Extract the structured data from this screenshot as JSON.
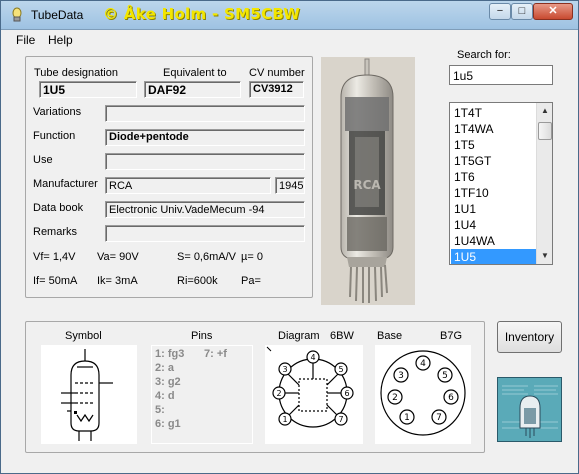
{
  "window": {
    "title": "TubeData",
    "author": "© Åke Holm - SM5CBW",
    "minimize_glyph": "−",
    "restore_glyph": "□",
    "close_glyph": "✕"
  },
  "menu": {
    "file": "File",
    "help": "Help"
  },
  "header": {
    "designation_label": "Tube designation",
    "designation": "1U5",
    "equivalent_label": "Equivalent to",
    "equivalent": "DAF92",
    "cv_label": "CV number",
    "cv": "CV3912"
  },
  "details": {
    "variations_label": "Variations",
    "variations": "",
    "function_label": "Function",
    "function": "Diode+pentode",
    "use_label": "Use",
    "use": "",
    "manufacturer_label": "Manufacturer",
    "manufacturer": "RCA",
    "year": "1945",
    "databook_label": "Data book",
    "databook": "Electronic Univ.VadeMecum -94",
    "remarks_label": "Remarks",
    "remarks": ""
  },
  "specs": {
    "vf": "Vf= 1,4V",
    "va": "Va=  90V",
    "s": "S= 0,6mA/V",
    "mu": "µ=     0",
    "if": "If= 50mA",
    "ik": "Ik=   3mA",
    "ri": "Ri=600k",
    "pa": "Pa="
  },
  "search": {
    "label": "Search for:",
    "value": "1u5",
    "results": [
      "1T4T",
      "1T4WA",
      "1T5",
      "1T5GT",
      "1T6",
      "1TF10",
      "1U1",
      "1U4",
      "1U4WA",
      "1U5"
    ],
    "selected": "1U5"
  },
  "bottom": {
    "symbol_label": "Symbol",
    "pins_label": "Pins",
    "diagram_label": "Diagram",
    "diagram_code": "6BW",
    "base_label": "Base",
    "base_code": "B7G",
    "pins": [
      "1: fg3",
      "2: a",
      "3: g2",
      "4: d",
      "5:",
      "6: g1"
    ],
    "pin7": "7: +f",
    "diagram_pins": [
      "1",
      "2",
      "3",
      "4",
      "5",
      "6",
      "7"
    ],
    "base_pins": [
      "1",
      "2",
      "3",
      "4",
      "5",
      "6",
      "7"
    ]
  },
  "inventory_button": "Inventory"
}
